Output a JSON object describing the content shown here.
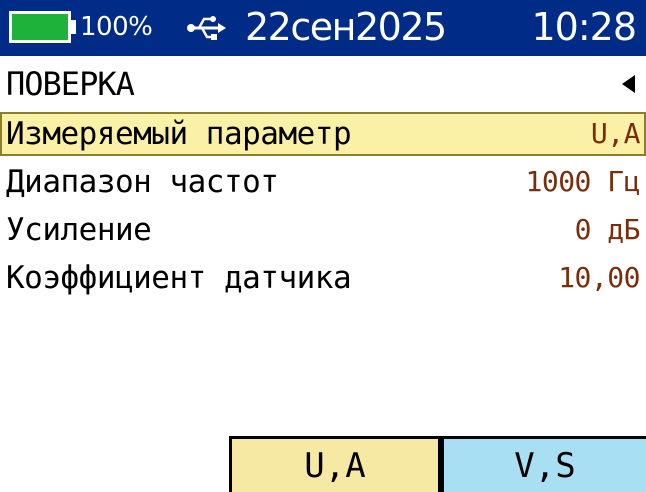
{
  "status_bar": {
    "battery_percent_text": "100%",
    "battery_level": 1.0,
    "usb_icon": "usb-icon",
    "date": "22сен2025",
    "time": "10:28",
    "colors": {
      "background": "#002b86",
      "battery_fill": "#1fb23a",
      "text": "#ffffff"
    }
  },
  "header": {
    "title": "ПОВЕРКА",
    "back_icon": "triangle-left-icon"
  },
  "parameters": [
    {
      "label": "Измеряемый параметр",
      "value": "U,A",
      "selected": true
    },
    {
      "label": "Диапазон частот",
      "value": "1000 Гц",
      "selected": false
    },
    {
      "label": "Усиление",
      "value": "0 дБ",
      "selected": false
    },
    {
      "label": "Коэффициент датчика",
      "value": "10,00",
      "selected": false
    }
  ],
  "softkeys": [
    {
      "label": "U,A",
      "color": "#f6e9a4"
    },
    {
      "label": "V,S",
      "color": "#a8dff2"
    }
  ],
  "colors": {
    "selection_background": "#faf0a6",
    "value_text": "#7a2d0a"
  }
}
